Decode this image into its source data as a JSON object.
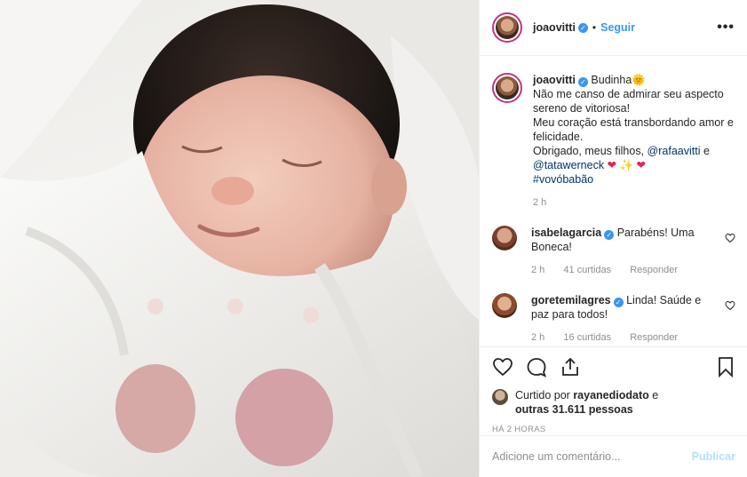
{
  "post": {
    "username": "joaovitti",
    "follow_label": "Seguir",
    "more_label": "•••",
    "separator": "•"
  },
  "caption": {
    "username": "joaovitti",
    "title": "Budinha",
    "emoji_sun": "🌞",
    "line1": "Não me canso de admirar seu aspecto sereno de vitoriosa!",
    "line2": "Meu coração está transbordando amor e felicidade.",
    "line3_prefix": "Obrigado, meus filhos, ",
    "mention1": "@rafaavitti",
    "line3_mid": " e",
    "mention2": "@tatawerneck",
    "emojis": "❤ ✨ ❤",
    "hashtag": "#vovóbabão",
    "time": "2 h"
  },
  "comments": [
    {
      "username": "isabelagarcia",
      "text": "Parabéns! Uma Boneca!",
      "time": "2 h",
      "likes": "41 curtidas",
      "reply": "Responder"
    },
    {
      "username": "goretemilagres",
      "text": "Linda! Saúde e paz para todos!",
      "time": "2 h",
      "likes": "16 curtidas",
      "reply": "Responder"
    }
  ],
  "likes": {
    "prefix": "Curtido por ",
    "user": "rayanediodato",
    "suffix": " e",
    "others": "outras 31.611 pessoas"
  },
  "timestamp": "HÁ 2 HORAS",
  "add_comment": {
    "placeholder": "Adicione um comentário...",
    "publish": "Publicar"
  },
  "colors": {
    "accent": "#3897f0",
    "publish_disabled": "#b2dffc",
    "muted": "#8e8e8e"
  }
}
